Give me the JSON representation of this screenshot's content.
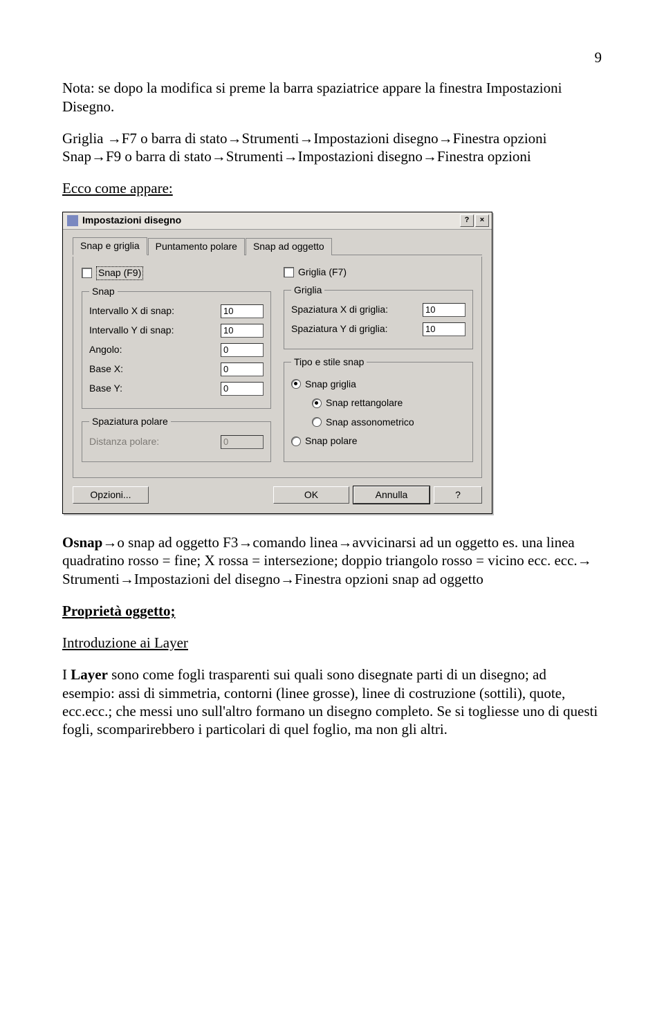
{
  "page_number": "9",
  "text": {
    "nota": "Nota: se dopo la modifica si preme la barra spaziatrice appare la finestra Impostazioni Disegno.",
    "griglia_line": "Griglia →F7 o barra di stato→Strumenti→Impostazioni disegno→Finestra opzioni",
    "snap_line": "Snap→F9 o barra di stato→Strumenti→Impostazioni disegno→Finestra opzioni",
    "ecco": "Ecco come appare:",
    "osnap_strong": "Osnap→",
    "osnap_rest": "o snap ad oggetto F3→comando linea→avvicinarsi ad un oggetto es. una linea quadratino rosso = fine; X rossa = intersezione; doppio triangolo rosso = vicino ecc. ecc.→ Strumenti→Impostazioni del disegno→Finestra opzioni snap ad oggetto",
    "proprieta": "Proprietà oggetto;",
    "intro_layer": "Introduzione ai Layer",
    "layer_para_a": "I ",
    "layer_para_b": "Layer",
    "layer_para_c": " sono come fogli trasparenti sui quali sono disegnate parti di un disegno; ad esempio: assi di simmetria, contorni (linee grosse), linee di costruzione (sottili), quote, ecc.ecc.; che messi uno sull'altro formano un disegno completo. Se si togliesse uno di questi fogli, scomparirebbero i particolari di quel foglio, ma non gli altri."
  },
  "dialog": {
    "title": "Impostazioni disegno",
    "help_btn": "?",
    "close_btn": "×",
    "tabs": [
      "Snap e griglia",
      "Puntamento polare",
      "Snap ad oggetto"
    ],
    "snap_check": "Snap (F9)",
    "griglia_check": "Griglia (F7)",
    "group_snap": "Snap",
    "group_griglia": "Griglia",
    "group_spazpol": "Spaziatura polare",
    "group_tipo": "Tipo e stile snap",
    "fields": {
      "intx": {
        "label": "Intervallo X di snap:",
        "value": "10"
      },
      "inty": {
        "label": "Intervallo Y di snap:",
        "value": "10"
      },
      "angolo": {
        "label": "Angolo:",
        "value": "0"
      },
      "basex": {
        "label": "Base X:",
        "value": "0"
      },
      "basey": {
        "label": "Base Y:",
        "value": "0"
      },
      "spazx": {
        "label": "Spaziatura X di griglia:",
        "value": "10"
      },
      "spazy": {
        "label": "Spaziatura Y di griglia:",
        "value": "10"
      },
      "distpol": {
        "label": "Distanza polare:",
        "value": "0"
      }
    },
    "radios": {
      "snap_griglia": "Snap griglia",
      "snap_rett": "Snap rettangolare",
      "snap_asso": "Snap assonometrico",
      "snap_polare": "Snap polare"
    },
    "buttons": {
      "opzioni": "Opzioni...",
      "ok": "OK",
      "annulla": "Annulla",
      "help": "?"
    }
  }
}
